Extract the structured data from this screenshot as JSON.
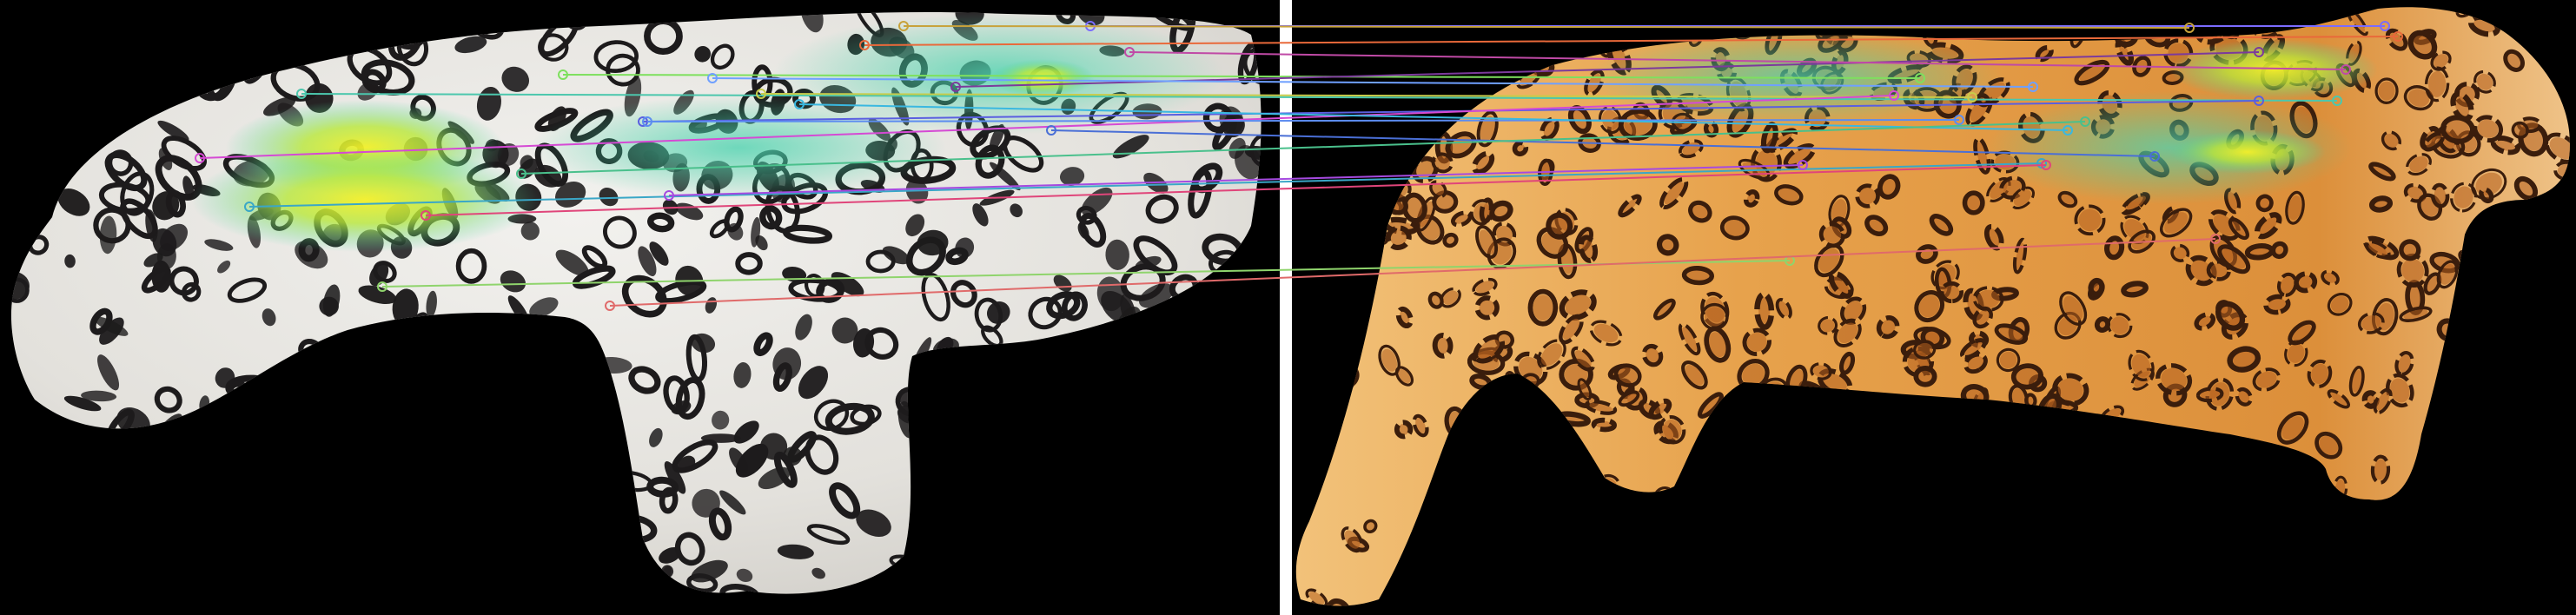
{
  "image": {
    "description_free": true,
    "left_panel": {
      "subject": "snow-leopard-pelt",
      "base_color": "#e9e7e2",
      "spot_color": "#1d1b1c"
    },
    "right_panel": {
      "subject": "leopard-pelt",
      "base_color": "#e8a554",
      "spot_color": "#3a1d0c"
    },
    "divider_color": "#ffffff",
    "heatmap_colors": [
      "#3fd6a6",
      "#b8e83a",
      "#f3f02a"
    ]
  },
  "matches": {
    "count": 20,
    "colors": [
      "#7b6cff",
      "#e9693a",
      "#7ee05e",
      "#4cc7ad",
      "#c8cc4a",
      "#5a5fe0",
      "#d54ad4",
      "#5c8cf0",
      "#3aa7c7",
      "#e0457a",
      "#c8a23a",
      "#4a6fd6",
      "#a64ae0",
      "#8fd46c",
      "#e06a6a",
      "#3ab8e0",
      "#7c3a9c",
      "#4ac08c",
      "#c04aa6",
      "#6fa0ff"
    ]
  }
}
